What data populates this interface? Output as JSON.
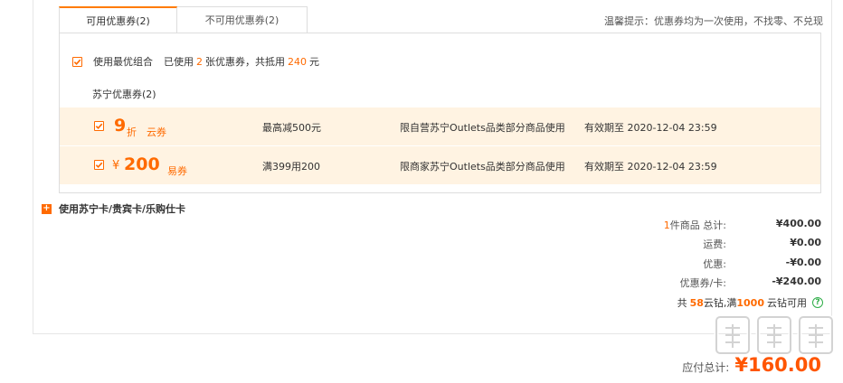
{
  "tabs": [
    {
      "label": "可用优惠券(2)"
    },
    {
      "label": "不可用优惠券(2)"
    }
  ],
  "tip": "温馨提示：优惠券均为一次使用，不找零、不兑现",
  "combo": {
    "label": "使用最优组合",
    "prefix": "已使用",
    "count": "2",
    "middle": "张优惠券，共抵用",
    "amount": "240",
    "unit": "元"
  },
  "group_title": "苏宁优惠券(2)",
  "coupons": [
    {
      "big": "9",
      "big_unit": "折",
      "type": "云券",
      "limit": "最高减500元",
      "scope": "限自营苏宁Outlets品类部分商品使用",
      "expiry": "有效期至 2020-12-04 23:59"
    },
    {
      "currency": "¥",
      "big": "200",
      "type": "易券",
      "limit": "满399用200",
      "scope": "限商家苏宁Outlets品类部分商品使用",
      "expiry": "有效期至 2020-12-04 23:59"
    }
  ],
  "card_option": "使用苏宁卡/贵宾卡/乐购仕卡",
  "summary": {
    "items_count": "1",
    "items_label": "件商品 总计:",
    "items_value": "¥400.00",
    "shipping_label": "运费:",
    "shipping_value": "¥0.00",
    "discount_label": "优惠:",
    "discount_value": "-¥0.00",
    "coupon_label": "优惠券/卡:",
    "coupon_value": "-¥240.00"
  },
  "coins": {
    "prefix": "共",
    "count": "58",
    "middle": "云钻,满",
    "threshold": "1000",
    "suffix": "云钻可用",
    "help": "?"
  },
  "pay": {
    "label": "应付总计:",
    "amount": "¥160.00"
  },
  "watermark": "值 什么值得买",
  "colors": {
    "accent": "#ff6a00",
    "coupon_bg": "#fff3e2",
    "help_green": "#2fae48"
  }
}
